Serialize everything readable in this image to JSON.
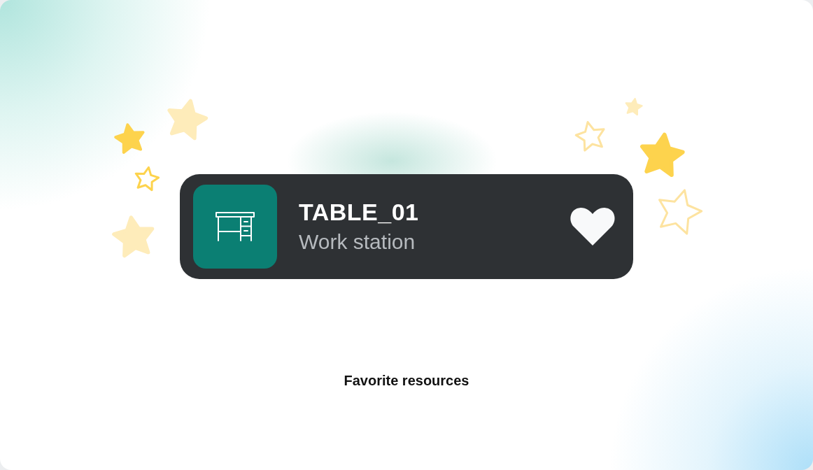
{
  "resource": {
    "name": "TABLE_01",
    "type": "Work station",
    "favorite": true
  },
  "caption": "Favorite resources"
}
